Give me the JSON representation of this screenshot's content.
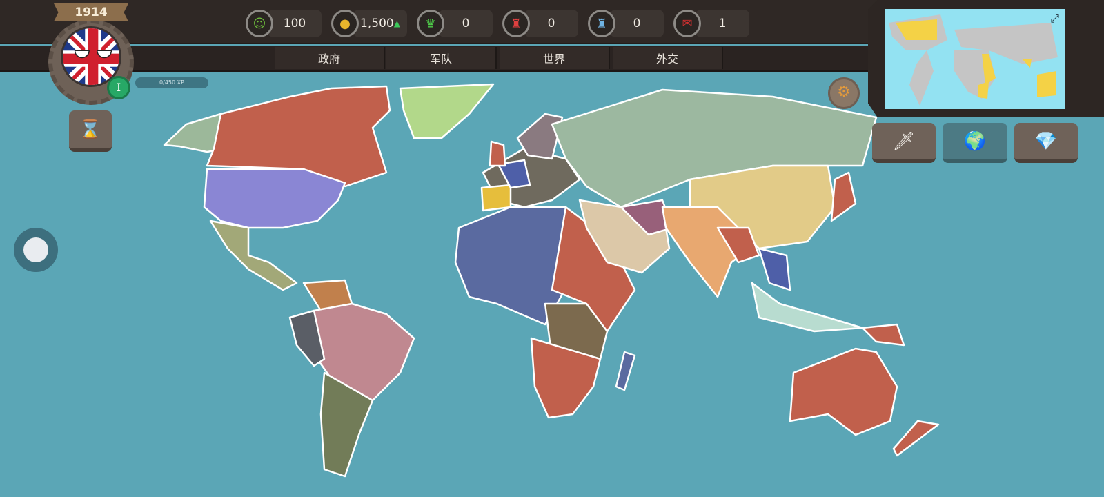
{
  "header": {
    "year": "1914",
    "country": "United Kingdom",
    "level": "I",
    "xp": "0/450 XP"
  },
  "resources": [
    {
      "icon": "happiness-icon",
      "value": "100",
      "color": "#6fc23c"
    },
    {
      "icon": "gold-coins-icon",
      "value": "1,500",
      "trend": "up",
      "color": "#e8b52c"
    },
    {
      "icon": "green-crown-icon",
      "value": "0",
      "color": "#4fcf4a"
    },
    {
      "icon": "red-crown-icon",
      "value": "0",
      "color": "#e04040"
    },
    {
      "icon": "blue-crown-icon",
      "value": "0",
      "color": "#6fb4e4"
    },
    {
      "icon": "diplomacy-letter-icon",
      "value": "1",
      "color": "#d03030"
    }
  ],
  "tabs": [
    {
      "label": "政府"
    },
    {
      "label": "军队"
    },
    {
      "label": "世界"
    },
    {
      "label": "外交"
    }
  ],
  "side_buttons": {
    "left": "scroll-history-icon",
    "right": [
      "sword-icon",
      "globe-icon",
      "diamond-icon"
    ]
  },
  "colors": {
    "ocean": "#5ba6b6",
    "player": "#f1cd4a",
    "minimap_ocean": "#93e2f2"
  }
}
